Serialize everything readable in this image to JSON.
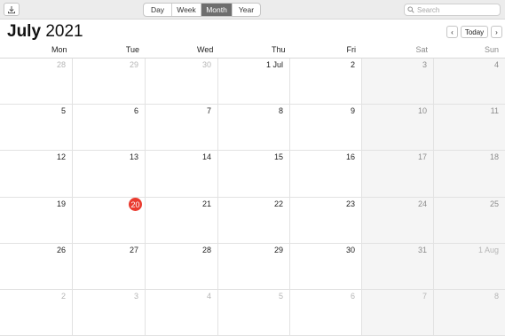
{
  "toolbar": {
    "import_icon": "download-icon",
    "view_tabs": [
      {
        "label": "Day",
        "active": false
      },
      {
        "label": "Week",
        "active": false
      },
      {
        "label": "Month",
        "active": true
      },
      {
        "label": "Year",
        "active": false
      }
    ],
    "search_placeholder": "Search",
    "search_icon": "magnifier-icon"
  },
  "header": {
    "month": "July",
    "year": "2021",
    "prev_glyph": "‹",
    "today_label": "Today",
    "next_glyph": "›"
  },
  "weekdays": [
    {
      "label": "Mon",
      "weekend": false
    },
    {
      "label": "Tue",
      "weekend": false
    },
    {
      "label": "Wed",
      "weekend": false
    },
    {
      "label": "Thu",
      "weekend": false
    },
    {
      "label": "Fri",
      "weekend": false
    },
    {
      "label": "Sat",
      "weekend": true
    },
    {
      "label": "Sun",
      "weekend": true
    }
  ],
  "weeks": [
    [
      {
        "label": "28",
        "other_month": true
      },
      {
        "label": "29",
        "other_month": true
      },
      {
        "label": "30",
        "other_month": true
      },
      {
        "label": "1 Jul",
        "other_month": false
      },
      {
        "label": "2",
        "other_month": false
      },
      {
        "label": "3",
        "other_month": false
      },
      {
        "label": "4",
        "other_month": false
      }
    ],
    [
      {
        "label": "5",
        "other_month": false
      },
      {
        "label": "6",
        "other_month": false
      },
      {
        "label": "7",
        "other_month": false
      },
      {
        "label": "8",
        "other_month": false
      },
      {
        "label": "9",
        "other_month": false
      },
      {
        "label": "10",
        "other_month": false
      },
      {
        "label": "11",
        "other_month": false
      }
    ],
    [
      {
        "label": "12",
        "other_month": false
      },
      {
        "label": "13",
        "other_month": false
      },
      {
        "label": "14",
        "other_month": false
      },
      {
        "label": "15",
        "other_month": false
      },
      {
        "label": "16",
        "other_month": false
      },
      {
        "label": "17",
        "other_month": false
      },
      {
        "label": "18",
        "other_month": false
      }
    ],
    [
      {
        "label": "19",
        "other_month": false
      },
      {
        "label": "20",
        "other_month": false,
        "today": true
      },
      {
        "label": "21",
        "other_month": false
      },
      {
        "label": "22",
        "other_month": false
      },
      {
        "label": "23",
        "other_month": false
      },
      {
        "label": "24",
        "other_month": false
      },
      {
        "label": "25",
        "other_month": false
      }
    ],
    [
      {
        "label": "26",
        "other_month": false
      },
      {
        "label": "27",
        "other_month": false
      },
      {
        "label": "28",
        "other_month": false
      },
      {
        "label": "29",
        "other_month": false
      },
      {
        "label": "30",
        "other_month": false
      },
      {
        "label": "31",
        "other_month": false
      },
      {
        "label": "1 Aug",
        "other_month": true
      }
    ],
    [
      {
        "label": "2",
        "other_month": true
      },
      {
        "label": "3",
        "other_month": true
      },
      {
        "label": "4",
        "other_month": true
      },
      {
        "label": "5",
        "other_month": true
      },
      {
        "label": "6",
        "other_month": true
      },
      {
        "label": "7",
        "other_month": true
      },
      {
        "label": "8",
        "other_month": true
      }
    ]
  ],
  "colors": {
    "today_marker": "#ea3b2f",
    "weekend_background": "#f5f5f5",
    "active_tab": "#6e6e6e"
  }
}
